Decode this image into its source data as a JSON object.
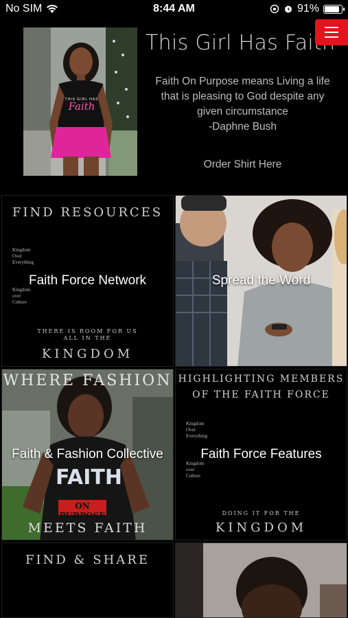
{
  "status_bar": {
    "carrier": "No SIM",
    "time": "8:44 AM",
    "battery_percent": "91%",
    "battery_level": 0.91
  },
  "hero": {
    "title": "This Girl Has Faith",
    "quote_line1": "Faith On Purpose means Living a life",
    "quote_line2": "that is pleasing to God despite any",
    "quote_line3": "given circumstance",
    "quote_author": "-Daphne Bush",
    "order_link": "Order Shirt Here",
    "shirt_text_small": "THIS GIRL HAS",
    "shirt_text_big": "Faith"
  },
  "menu_icon": "hamburger-icon",
  "colors": {
    "accent": "#e3141c",
    "background": "#000000"
  },
  "tiles": [
    {
      "label": "Faith Force Network",
      "header": "FIND RESOURCES",
      "small_1": [
        "Kingdom",
        "Over",
        "Everything"
      ],
      "small_2": [
        "Kingdom",
        "over",
        "Culture"
      ],
      "footer_small_1": "THERE IS ROOM FOR US",
      "footer_small_2": "ALL IN THE",
      "footer_big": "KINGDOM"
    },
    {
      "label": "Spread the Word"
    },
    {
      "label": "Faith & Fashion Collective",
      "header": "WHERE FASHION",
      "footer_big": "MEETS FAITH",
      "shirt_text": "FAITH",
      "shirt_text_2": "ON PURPOSE"
    },
    {
      "label": "Faith Force Features",
      "header_1": "HIGHLIGHTING MEMBERS",
      "header_2": "OF THE FAITH FORCE",
      "small_1": [
        "Kingdom",
        "Over",
        "Everything"
      ],
      "small_2": [
        "Kingdom",
        "over",
        "Culture"
      ],
      "footer_small": "DOING IT FOR THE",
      "footer_big": "KINGDOM"
    },
    {
      "header": "FIND & SHARE"
    },
    {}
  ]
}
